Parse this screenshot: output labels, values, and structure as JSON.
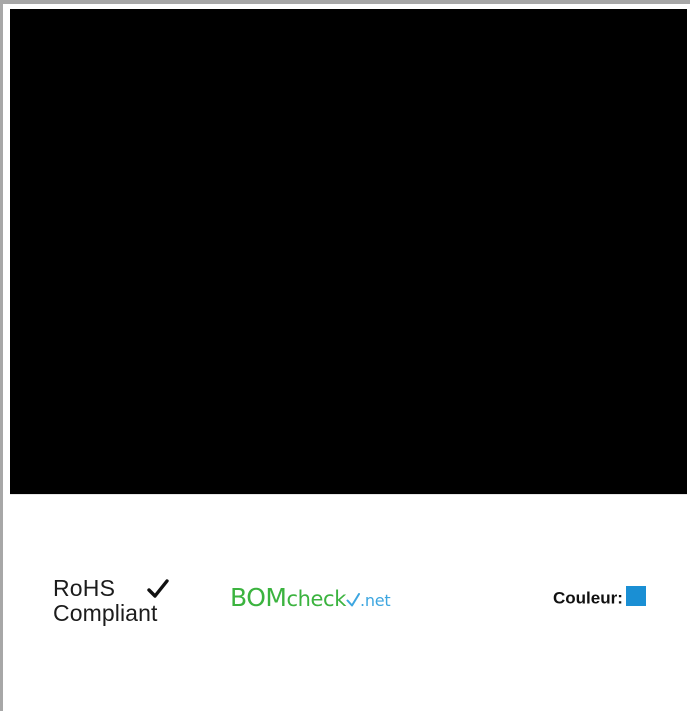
{
  "badges": {
    "rohs": {
      "line1": "RoHS",
      "line2": "Compliant",
      "icon": "checkmark-icon"
    },
    "bomcheck": {
      "bom": "BOM",
      "check": "check",
      "net": ".net",
      "icon": "checkmark-icon",
      "colors": {
        "primary": "#3bb33f",
        "secondary": "#3da6e0"
      }
    }
  },
  "color_info": {
    "label": "Couleur:",
    "swatch_color": "#1a8fd4"
  },
  "colors": {
    "media_panel": "#000000",
    "frame_border": "#a7a7a7"
  }
}
